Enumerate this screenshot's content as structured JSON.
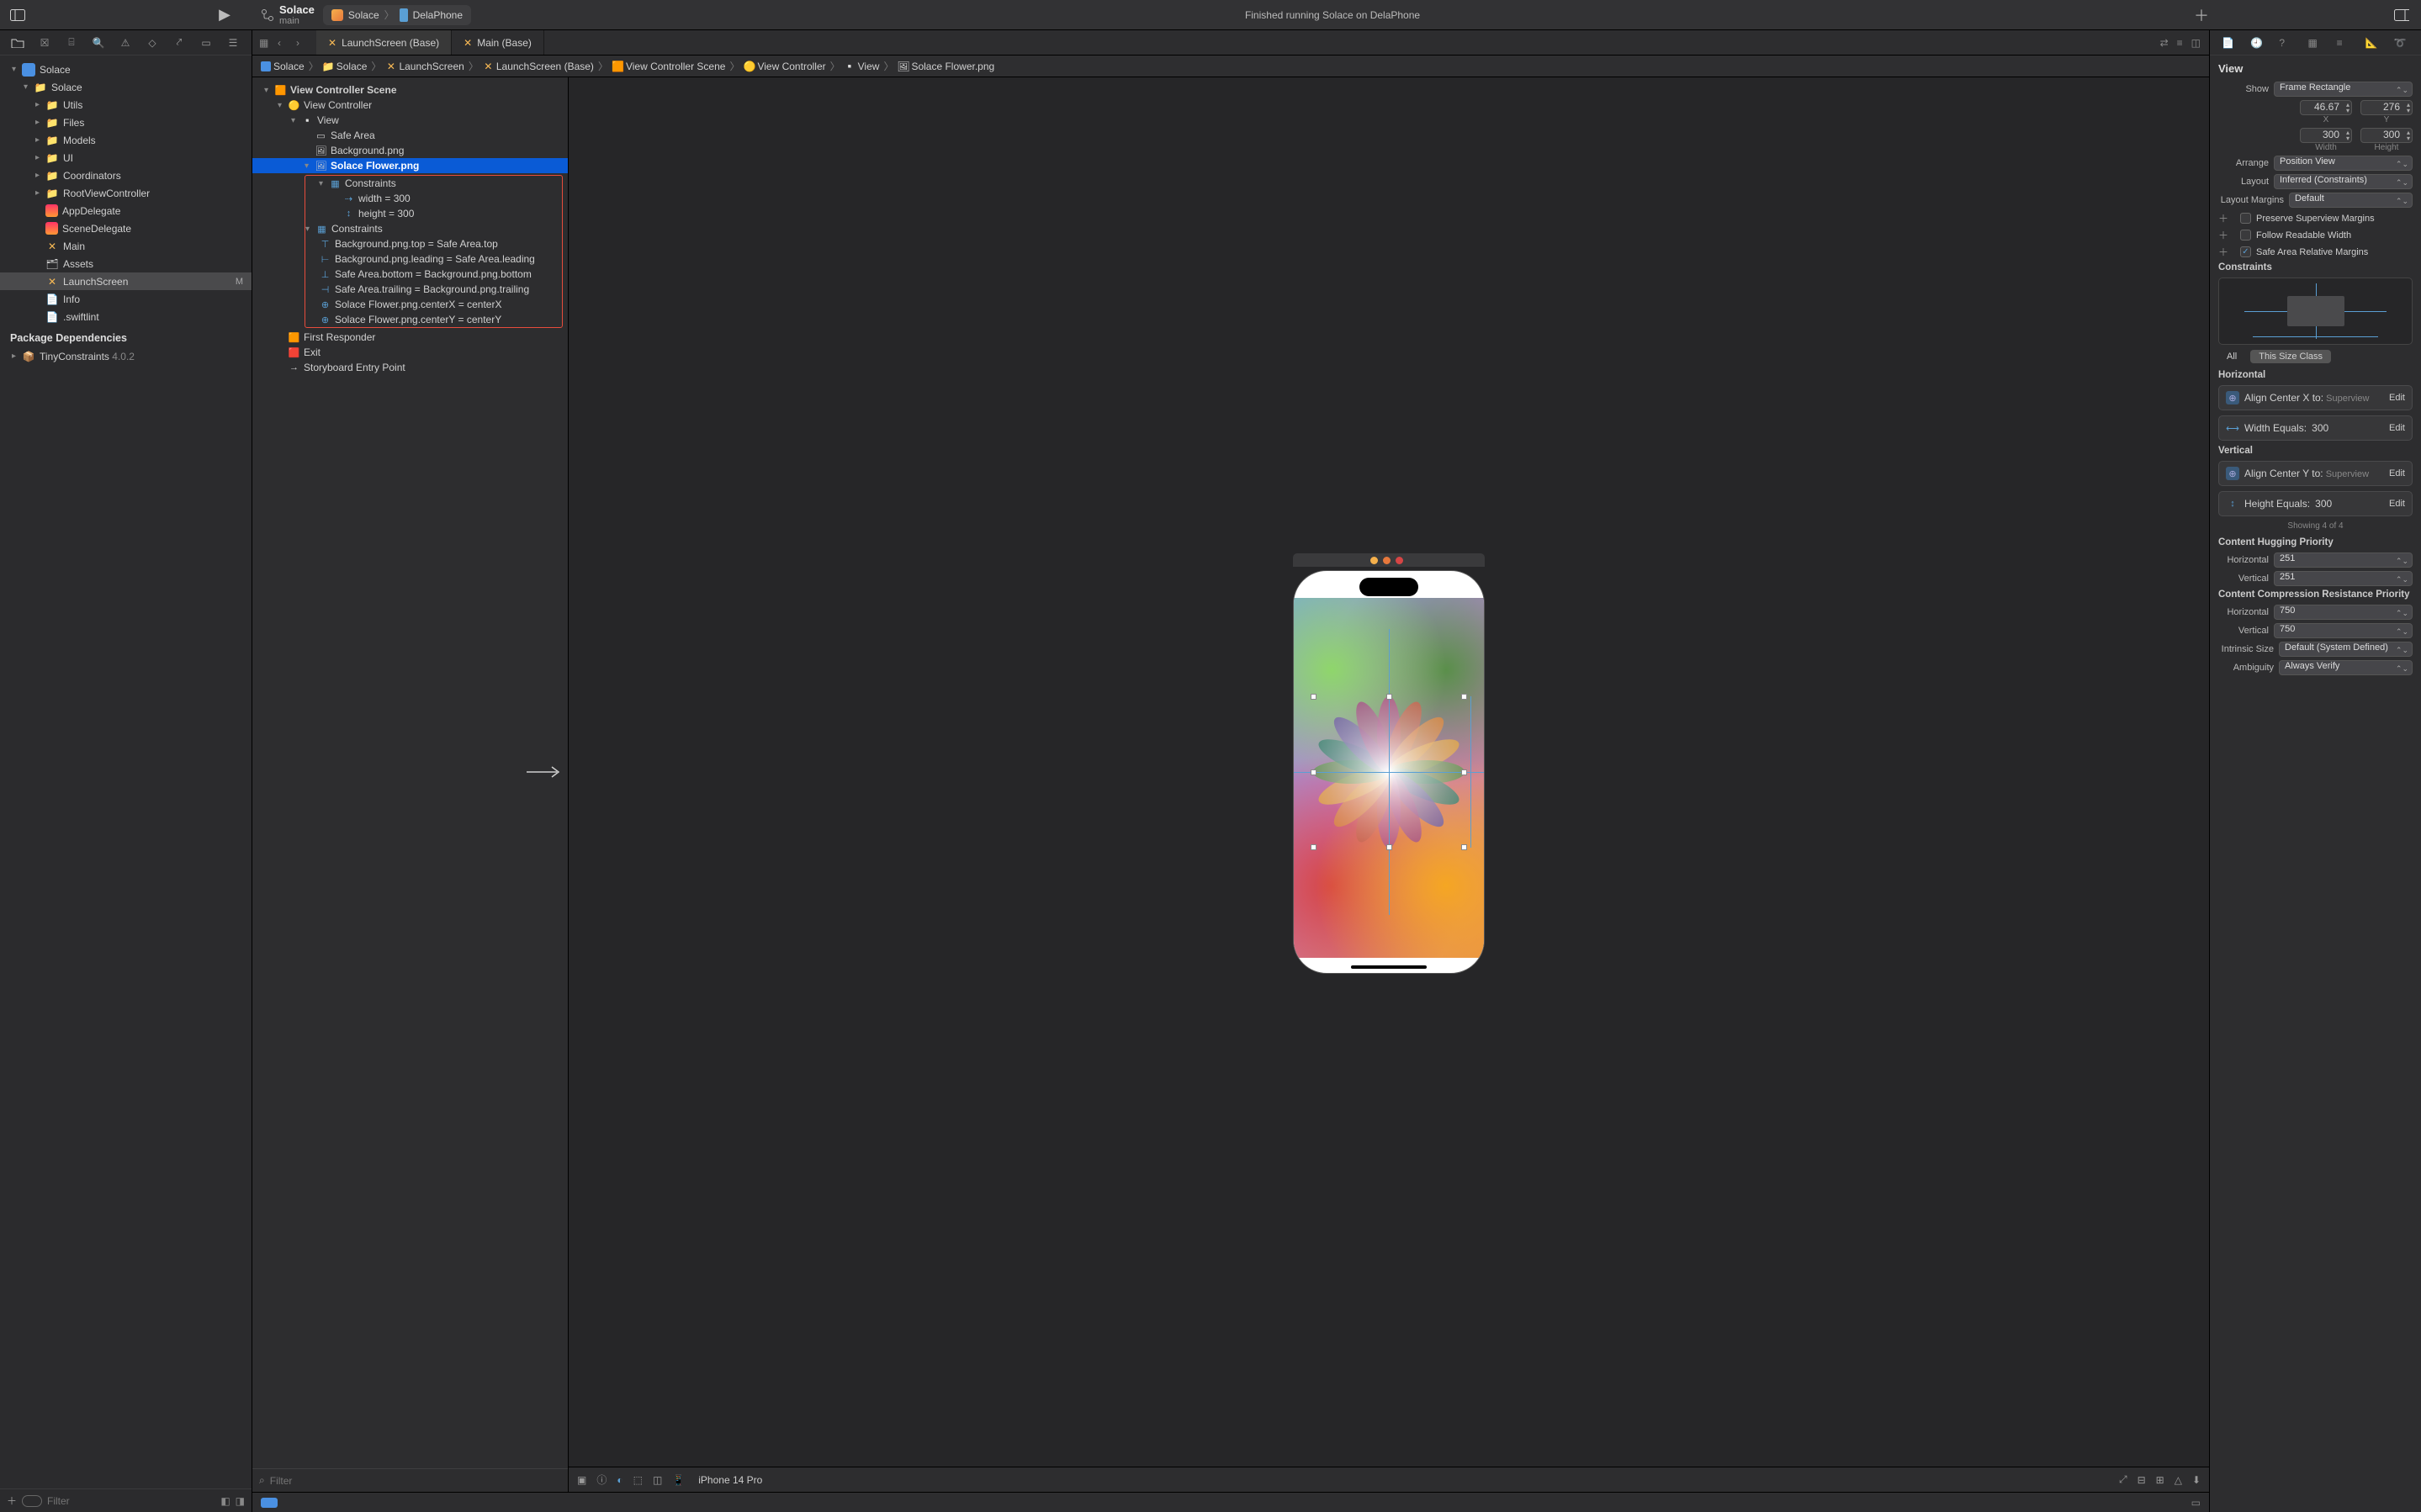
{
  "titlebar": {
    "project_name": "Solace",
    "branch": "main",
    "scheme_app": "Solace",
    "scheme_dest": "DelaPhone",
    "status_text": "Finished running Solace on DelaPhone"
  },
  "navigator": {
    "root": "Solace",
    "filter_placeholder": "Filter",
    "items": [
      {
        "label": "Solace",
        "icon": "folder",
        "indent": 2,
        "disclosure": "open"
      },
      {
        "label": "Utils",
        "icon": "folder",
        "indent": 3,
        "disclosure": "closed"
      },
      {
        "label": "Files",
        "icon": "folder",
        "indent": 3,
        "disclosure": "closed"
      },
      {
        "label": "Models",
        "icon": "folder",
        "indent": 3,
        "disclosure": "closed"
      },
      {
        "label": "UI",
        "icon": "folder",
        "indent": 3,
        "disclosure": "closed"
      },
      {
        "label": "Coordinators",
        "icon": "folder",
        "indent": 3,
        "disclosure": "closed"
      },
      {
        "label": "RootViewController",
        "icon": "folder",
        "indent": 3,
        "disclosure": "closed"
      },
      {
        "label": "AppDelegate",
        "icon": "swift",
        "indent": 3
      },
      {
        "label": "SceneDelegate",
        "icon": "swift",
        "indent": 3
      },
      {
        "label": "Main",
        "icon": "storyboard",
        "indent": 3
      },
      {
        "label": "Assets",
        "icon": "assets",
        "indent": 3
      },
      {
        "label": "LaunchScreen",
        "icon": "storyboard",
        "indent": 3,
        "selected": true,
        "status": "M"
      },
      {
        "label": "Info",
        "icon": "plist",
        "indent": 3
      },
      {
        "label": ".swiftlint",
        "icon": "text",
        "indent": 3
      }
    ],
    "packages_header": "Package Dependencies",
    "packages": [
      {
        "name": "TinyConstraints",
        "version": "4.0.2"
      }
    ]
  },
  "tabs": [
    {
      "label": "LaunchScreen (Base)",
      "active": true,
      "icon": "storyboard"
    },
    {
      "label": "Main (Base)",
      "active": false,
      "icon": "storyboard"
    }
  ],
  "breadcrumb": [
    "Solace",
    "Solace",
    "LaunchScreen",
    "LaunchScreen (Base)",
    "View Controller Scene",
    "View Controller",
    "View",
    "Solace Flower.png"
  ],
  "outline": {
    "filter_placeholder": "Filter",
    "rows": [
      {
        "label": "View Controller Scene",
        "indent": 1,
        "icon": "scene",
        "disclosure": "open",
        "bold": true
      },
      {
        "label": "View Controller",
        "indent": 2,
        "icon": "vc",
        "disclosure": "open"
      },
      {
        "label": "View",
        "indent": 3,
        "icon": "view",
        "disclosure": "open"
      },
      {
        "label": "Safe Area",
        "indent": 4,
        "icon": "safe"
      },
      {
        "label": "Background.png",
        "indent": 4,
        "icon": "img"
      },
      {
        "label": "Solace Flower.png",
        "indent": 4,
        "icon": "img",
        "disclosure": "open",
        "selected": true
      },
      {
        "label": "Constraints",
        "indent": 5,
        "icon": "constr",
        "disclosure": "open",
        "inbox": true
      },
      {
        "label": "width = 300",
        "indent": 6,
        "icon": "width",
        "inbox": true
      },
      {
        "label": "height = 300",
        "indent": 6,
        "icon": "height",
        "inbox": true
      },
      {
        "label": "Constraints",
        "indent": 4,
        "icon": "constr",
        "disclosure": "open",
        "inbox": true
      },
      {
        "label": "Background.png.top = Safe Area.top",
        "indent": 5,
        "icon": "ctop",
        "inbox": true
      },
      {
        "label": "Background.png.leading = Safe Area.leading",
        "indent": 5,
        "icon": "clead",
        "inbox": true
      },
      {
        "label": "Safe Area.bottom = Background.png.bottom",
        "indent": 5,
        "icon": "cbot",
        "inbox": true
      },
      {
        "label": "Safe Area.trailing = Background.png.trailing",
        "indent": 5,
        "icon": "ctrail",
        "inbox": true
      },
      {
        "label": "Solace Flower.png.centerX = centerX",
        "indent": 5,
        "icon": "ccx",
        "inbox": true
      },
      {
        "label": "Solace Flower.png.centerY = centerY",
        "indent": 5,
        "icon": "ccy",
        "inbox": true
      },
      {
        "label": "First Responder",
        "indent": 2,
        "icon": "fr"
      },
      {
        "label": "Exit",
        "indent": 2,
        "icon": "exit"
      },
      {
        "label": "Storyboard Entry Point",
        "indent": 2,
        "icon": "entry"
      }
    ]
  },
  "canvas": {
    "device": "iPhone 14 Pro"
  },
  "inspector": {
    "title": "View",
    "show_label": "Show",
    "show_value": "Frame Rectangle",
    "x": "46.67",
    "y": "276",
    "x_lbl": "X",
    "y_lbl": "Y",
    "w": "300",
    "h": "300",
    "w_lbl": "Width",
    "h_lbl": "Height",
    "arrange_label": "Arrange",
    "arrange_value": "Position View",
    "layout_label": "Layout",
    "layout_value": "Inferred (Constraints)",
    "margins_label": "Layout Margins",
    "margins_value": "Default",
    "check1": "Preserve Superview Margins",
    "check2": "Follow Readable Width",
    "check3": "Safe Area Relative Margins",
    "constraints_header": "Constraints",
    "filter_all": "All",
    "filter_this": "This Size Class",
    "horizontal_header": "Horizontal",
    "h1_text": "Align Center X to:",
    "h1_sub": "Superview",
    "edit": "Edit",
    "h2_text": "Width Equals:",
    "h2_val": "300",
    "vertical_header": "Vertical",
    "v1_text": "Align Center Y to:",
    "v1_sub": "Superview",
    "v2_text": "Height Equals:",
    "v2_val": "300",
    "showing_caption": "Showing 4 of 4",
    "hugging_header": "Content Hugging Priority",
    "hug_h_label": "Horizontal",
    "hug_h": "251",
    "hug_v_label": "Vertical",
    "hug_v": "251",
    "compress_header": "Content Compression Resistance Priority",
    "comp_h_label": "Horizontal",
    "comp_h": "750",
    "comp_v_label": "Vertical",
    "comp_v": "750",
    "intrinsic_label": "Intrinsic Size",
    "intrinsic_value": "Default (System Defined)",
    "ambiguity_label": "Ambiguity",
    "ambiguity_value": "Always Verify"
  }
}
